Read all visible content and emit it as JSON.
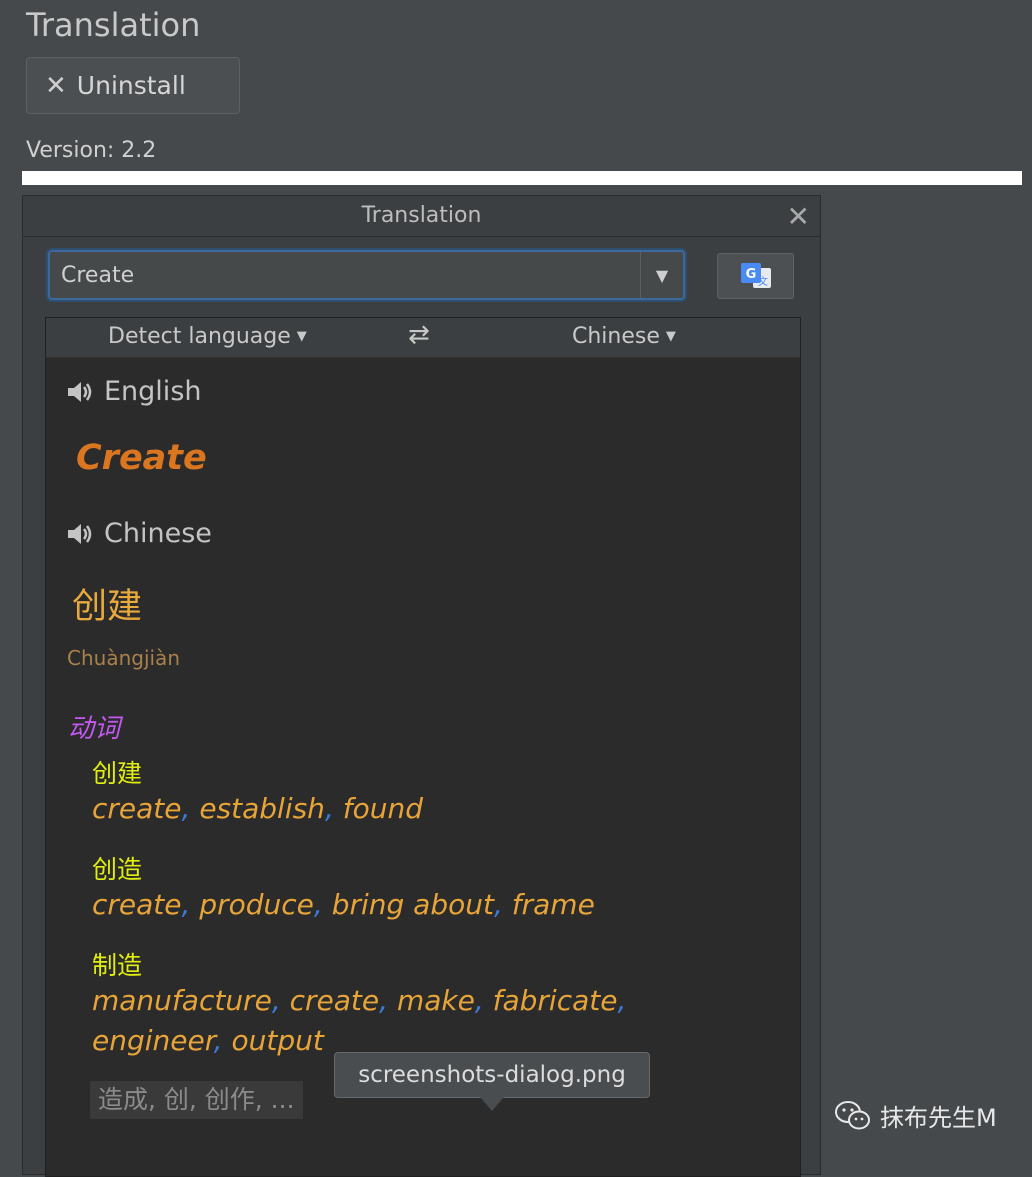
{
  "plugin": {
    "title": "Translation",
    "uninstall_label": "Uninstall",
    "version": "Version: 2.2"
  },
  "dialog": {
    "title": "Translation",
    "input_value": "Create",
    "source_lang": "Detect language",
    "target_lang": "Chinese"
  },
  "result": {
    "source_lang_label": "English",
    "source_text": "Create",
    "target_lang_label": "Chinese",
    "target_text": "创建",
    "phonetic": "Chuàngjiàn",
    "part_of_speech": "动词",
    "entries": [
      {
        "word": "创建",
        "synonyms": [
          "create",
          "establish",
          "found"
        ]
      },
      {
        "word": "创造",
        "synonyms": [
          "create",
          "produce",
          "bring about",
          "frame"
        ]
      },
      {
        "word": "制造",
        "line1": [
          "manufacture",
          "create",
          "make",
          "fabricate"
        ],
        "line2": [
          "engineer",
          "output"
        ]
      }
    ],
    "more_label": "造成, 创, 创作, ..."
  },
  "tooltip": "screenshots-dialog.png",
  "watermark": "抹布先生M",
  "colors": {
    "source_text": "#db7620",
    "target_text": "#e9a93c",
    "part_of_speech": "#c558f2",
    "dict_word": "#e2ee0f",
    "synonym": "#e7a439",
    "separator": "#3b7bd4"
  }
}
